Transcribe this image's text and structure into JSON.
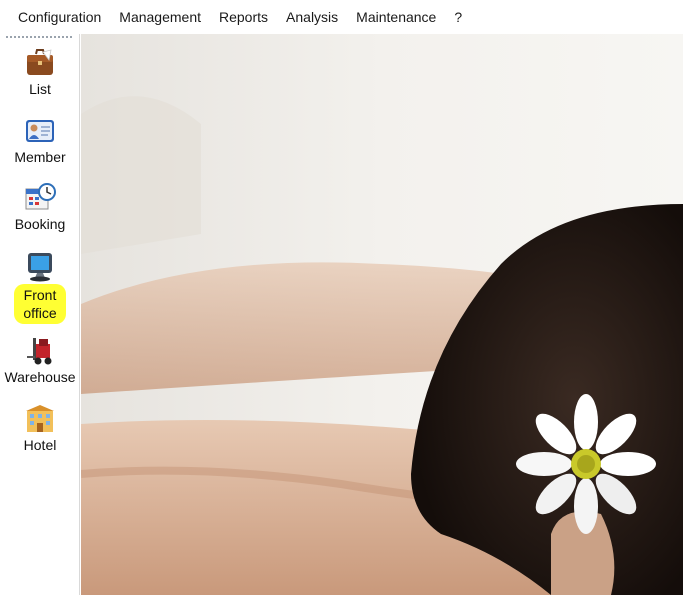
{
  "menu": {
    "items": [
      "Configuration",
      "Management",
      "Reports",
      "Analysis",
      "Maintenance",
      "?"
    ]
  },
  "sidebar": {
    "items": [
      {
        "label": "List",
        "icon": "briefcase-icon"
      },
      {
        "label": "Member",
        "icon": "member-card-icon"
      },
      {
        "label": "Booking",
        "icon": "calendar-clock-icon"
      },
      {
        "label": "Front office",
        "icon": "monitor-icon",
        "highlighted": true
      },
      {
        "label": "Warehouse",
        "icon": "forklift-icon"
      },
      {
        "label": "Hotel",
        "icon": "hotel-building-icon"
      }
    ]
  },
  "colors": {
    "highlight": "#ffff33",
    "menu_text": "#1a1a1a",
    "sidebar_border": "#d9d9d9"
  }
}
